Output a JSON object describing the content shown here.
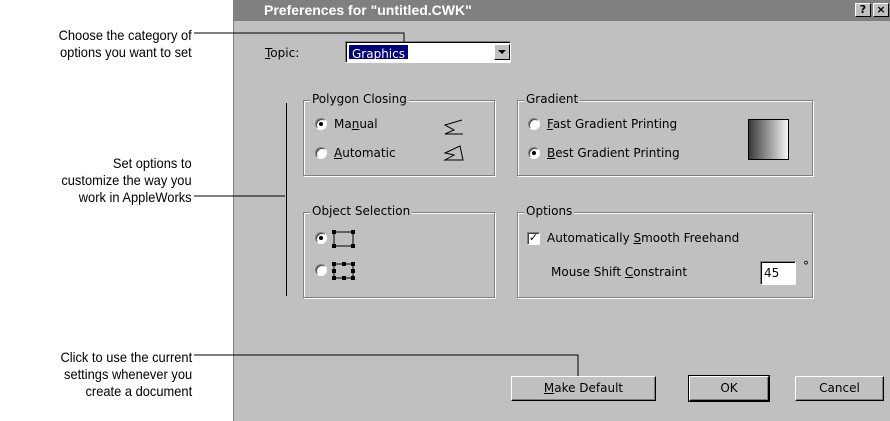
{
  "callouts": {
    "category_line1": "Choose the category of",
    "category_line2": "options you want to set",
    "options_line1": "Set options to",
    "options_line2": "customize the way you",
    "options_line3": "work in AppleWorks",
    "default_line1": "Click to use the current",
    "default_line2": "settings whenever you",
    "default_line3": "create a document"
  },
  "dialog": {
    "title": "Preferences for \"untitled.CWK\"",
    "help_button": "?",
    "close_button": "×"
  },
  "topic": {
    "label_first": "T",
    "label_rest": "opic:",
    "selected": "Graphics"
  },
  "polygon_closing": {
    "title": "Polygon Closing",
    "options": [
      {
        "pre": "Ma",
        "key": "n",
        "post": "ual",
        "selected": true
      },
      {
        "pre": "",
        "key": "A",
        "post": "utomatic",
        "selected": false
      }
    ]
  },
  "gradient": {
    "title": "Gradient",
    "options": [
      {
        "pre": "",
        "key": "F",
        "post": "ast Gradient Printing",
        "selected": false
      },
      {
        "pre": "",
        "key": "B",
        "post": "est Gradient Printing",
        "selected": true
      }
    ]
  },
  "object_selection": {
    "title": "Object Selection",
    "options": [
      {
        "name": "corner-handles",
        "selected": true
      },
      {
        "name": "all-handles",
        "selected": false
      }
    ]
  },
  "options_group": {
    "title": "Options",
    "smooth_pre": "Automatically ",
    "smooth_key": "S",
    "smooth_post": "mooth Freehand",
    "smooth_checked": true,
    "shift_pre": "Mouse Shift ",
    "shift_key": "C",
    "shift_post": "onstraint",
    "shift_value": "45",
    "shift_unit": "°"
  },
  "buttons": {
    "make_default_key": "M",
    "make_default_rest": "ake Default",
    "ok": "OK",
    "cancel": "Cancel"
  },
  "icons": [
    "polygon-open-icon",
    "polygon-closed-icon",
    "dropdown-arrow-icon",
    "selection-corner-handles-icon",
    "selection-all-handles-icon",
    "gradient-swatch-icon"
  ],
  "colors": {
    "dialog_face": "#c0c0c0",
    "titlebar": "#808080",
    "title_text": "#ffffff",
    "topic_highlight": "#000080"
  }
}
